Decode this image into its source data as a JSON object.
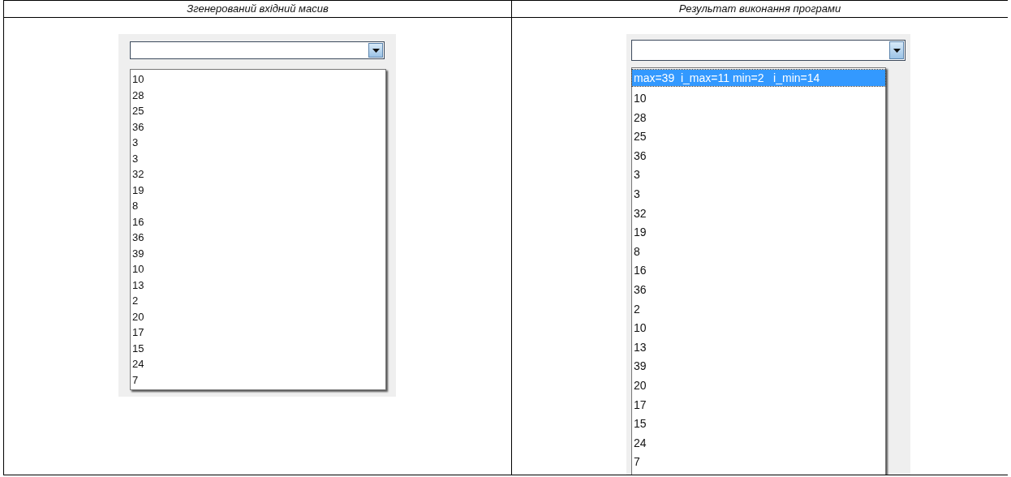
{
  "table": {
    "columns": [
      {
        "heading": "Згенерований вхідний масив",
        "combo": {
          "items": [
            {
              "label": "10",
              "selected": false
            },
            {
              "label": "28",
              "selected": false
            },
            {
              "label": "25",
              "selected": false
            },
            {
              "label": "36",
              "selected": false
            },
            {
              "label": "3",
              "selected": false
            },
            {
              "label": "3",
              "selected": false
            },
            {
              "label": "32",
              "selected": false
            },
            {
              "label": "19",
              "selected": false
            },
            {
              "label": "8",
              "selected": false
            },
            {
              "label": "16",
              "selected": false
            },
            {
              "label": "36",
              "selected": false
            },
            {
              "label": "39",
              "selected": false
            },
            {
              "label": "10",
              "selected": false
            },
            {
              "label": "13",
              "selected": false
            },
            {
              "label": "2",
              "selected": false
            },
            {
              "label": "20",
              "selected": false
            },
            {
              "label": "17",
              "selected": false
            },
            {
              "label": "15",
              "selected": false
            },
            {
              "label": "24",
              "selected": false
            },
            {
              "label": "7",
              "selected": false
            }
          ]
        }
      },
      {
        "heading": "Результат виконання програми",
        "combo": {
          "items": [
            {
              "label": "max=39  i_max=11 min=2   i_min=14",
              "selected": true
            },
            {
              "label": "10",
              "selected": false
            },
            {
              "label": "28",
              "selected": false
            },
            {
              "label": "25",
              "selected": false
            },
            {
              "label": "36",
              "selected": false
            },
            {
              "label": "3",
              "selected": false
            },
            {
              "label": "3",
              "selected": false
            },
            {
              "label": "32",
              "selected": false
            },
            {
              "label": "19",
              "selected": false
            },
            {
              "label": "8",
              "selected": false
            },
            {
              "label": "16",
              "selected": false
            },
            {
              "label": "36",
              "selected": false
            },
            {
              "label": "2",
              "selected": false
            },
            {
              "label": "10",
              "selected": false
            },
            {
              "label": "13",
              "selected": false
            },
            {
              "label": "39",
              "selected": false
            },
            {
              "label": "20",
              "selected": false
            },
            {
              "label": "17",
              "selected": false
            },
            {
              "label": "15",
              "selected": false
            },
            {
              "label": "24",
              "selected": false
            },
            {
              "label": "7",
              "selected": false
            }
          ]
        }
      }
    ]
  }
}
